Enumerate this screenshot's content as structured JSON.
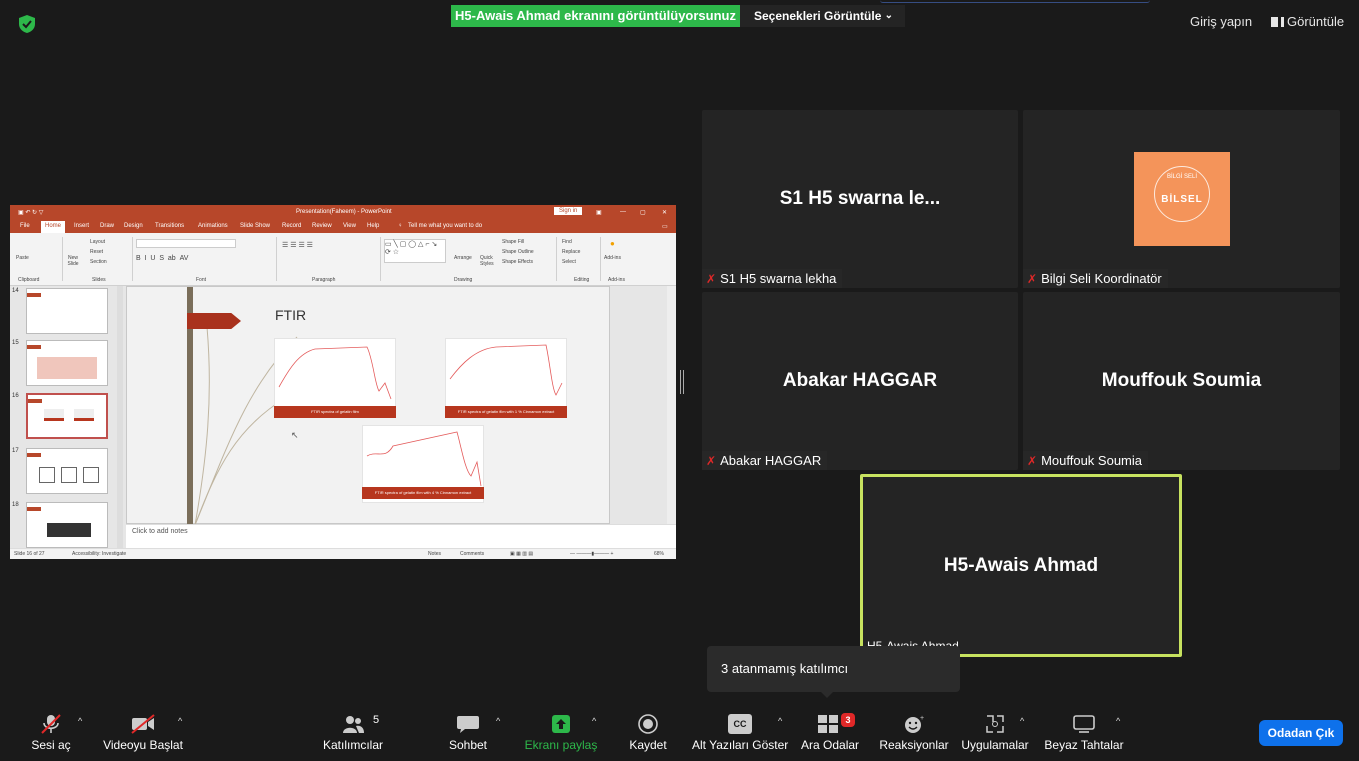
{
  "top_bar": {
    "share_banner": "H5-Awais Ahmad ekranını görüntülüyorsunuz",
    "view_options": "Seçenekleri Görüntüle",
    "sign_in": "Giriş yapın",
    "view": "Görüntüle"
  },
  "shared_screen": {
    "window_title": "Presentation(Faheem) - PowerPoint",
    "sign_in": "Sign in",
    "tell_me": "Tell me what you want to do",
    "tabs": [
      "File",
      "Home",
      "Insert",
      "Draw",
      "Design",
      "Transitions",
      "Animations",
      "Slide Show",
      "Record",
      "Review",
      "View",
      "Help"
    ],
    "ribbon_groups": [
      "Clipboard",
      "Slides",
      "Font",
      "Paragraph",
      "Drawing",
      "Editing",
      "Add-ins"
    ],
    "ribbon_items": {
      "paste": "Paste",
      "new_slide": "New Slide",
      "layout": "Layout",
      "reset": "Reset",
      "section": "Section",
      "find": "Find",
      "replace": "Replace",
      "select": "Select",
      "arrange": "Arrange",
      "quick_styles": "Quick Styles",
      "shape_fill": "Shape Fill",
      "shape_outline": "Shape Outline",
      "shape_effects": "Shape Effects",
      "addins": "Add-ins"
    },
    "thumbnails": [
      "14",
      "15",
      "16",
      "17",
      "18"
    ],
    "slide_title": "FTIR",
    "spectra_captions": [
      "FTIR spectra of gelatin film",
      "FTIR spectra of gelatin film with 1 % Cinnamon extract",
      "FTIR spectra of gelatin film with 4 % Cinnamon extract"
    ],
    "notes_placeholder": "Click to add notes",
    "status": {
      "slide_count": "Slide 16 of 27",
      "accessibility": "Accessibility: Investigate",
      "notes": "Notes",
      "comments": "Comments",
      "zoom": "68%"
    }
  },
  "participants": [
    {
      "display": "S1 H5 swarna le...",
      "label": "S1 H5 swarna lekha"
    },
    {
      "display": "",
      "label": "Bilgi Seli Koordinatör",
      "logo_small": "BİLGİ SELİ",
      "logo_big": "BİLSEL"
    },
    {
      "display": "Abakar HAGGAR",
      "label": "Abakar HAGGAR"
    },
    {
      "display": "Mouffouk Soumia",
      "label": "Mouffouk Soumia"
    },
    {
      "display": "H5-Awais Ahmad",
      "label": "H5-Awais Ahmad"
    }
  ],
  "tooltip": "3 atanmamış katılımcı",
  "toolbar": {
    "mute": "Sesi aç",
    "video": "Videoyu Başlat",
    "participants": "Katılımcılar",
    "participants_count": "5",
    "chat": "Sohbet",
    "share": "Ekranı paylaş",
    "record": "Kaydet",
    "captions": "Alt Yazıları Göster",
    "captions_icon": "CC",
    "breakout": "Ara Odalar",
    "breakout_badge": "3",
    "reactions": "Reaksiyonlar",
    "apps": "Uygulamalar",
    "whiteboard": "Beyaz Tahtalar",
    "leave": "Odadan Çık"
  },
  "colors": {
    "banner_green": "#2db84a",
    "active_speaker": "#c7e25f",
    "leave_blue": "#0e71eb",
    "powerpoint_red": "#b7472a",
    "muted_red": "#e02828"
  }
}
